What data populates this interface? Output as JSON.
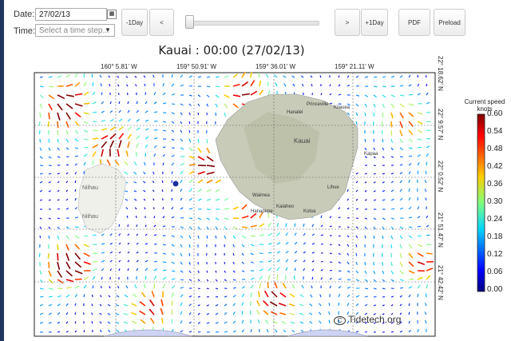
{
  "controls": {
    "date_label": "Date:",
    "date_value": "27/02/13",
    "time_label": "Time:",
    "time_placeholder": "Select a time step...",
    "minus_day_label": "-1Day",
    "prev_label": "<",
    "next_label": ">",
    "plus_day_label": "+1Day",
    "pdf_label": "PDF",
    "preload_label": "Preload"
  },
  "map": {
    "title": "Kauai : 00:00 (27/02/13)",
    "lon_labels": [
      "160° 5.81' W",
      "159° 50.91' W",
      "159° 36.01' W",
      "159° 21.11' W"
    ],
    "lat_labels": [
      "22° 18.62' N",
      "22° 9.57' N",
      "22° 0.52' N",
      "21° 51.47' N",
      "21° 42.42' N"
    ],
    "place_labels": [
      "Niihau",
      "Niihau",
      "Waimea",
      "Hanapepe",
      "Kalaheo",
      "Koloa",
      "Lihue",
      "Kapaa",
      "Kauai",
      "Hanalei",
      "Princeville",
      "Kilauea"
    ],
    "watermark": "Tidetech.org",
    "colorbar_title": "Current speed knots",
    "colorbar_ticks": [
      "0.60",
      "0.54",
      "0.48",
      "0.42",
      "0.36",
      "0.30",
      "0.24",
      "0.18",
      "0.12",
      "0.06",
      "0.00"
    ],
    "colors": {
      "low": "#00007f",
      "mid": "#7fff7f",
      "high": "#7f0000",
      "land": "#c8cbb8"
    },
    "icons": {
      "calendar": "calendar-icon",
      "dropdown": "chevron-down-icon",
      "copyright": "copyright-icon"
    }
  }
}
